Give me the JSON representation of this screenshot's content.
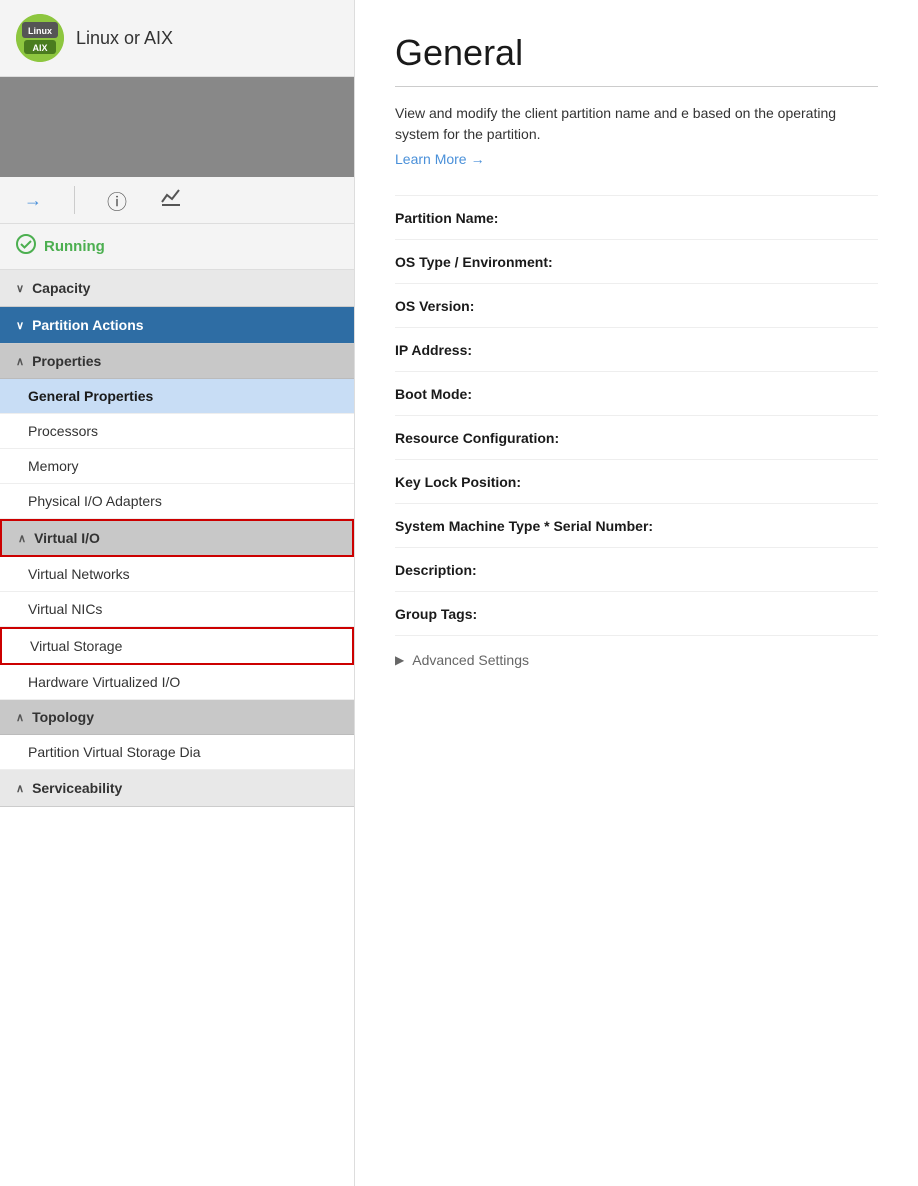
{
  "sidebar": {
    "logo": {
      "linux_label": "Linux",
      "aix_label": "AIX"
    },
    "title": "Linux or AIX",
    "nav": {
      "arrow": "→",
      "info_icon": "ⓘ",
      "chart_icon": "📈"
    },
    "status": {
      "label": "Running",
      "icon": "✔"
    },
    "sections": [
      {
        "id": "capacity",
        "label": "Capacity",
        "chevron": "∨",
        "active": false,
        "items": []
      },
      {
        "id": "partition-actions",
        "label": "Partition Actions",
        "chevron": "∨",
        "active": true,
        "items": []
      },
      {
        "id": "properties",
        "label": "Properties",
        "chevron": "∧",
        "sub": true,
        "items": [
          {
            "id": "general-properties",
            "label": "General Properties",
            "active": true
          },
          {
            "id": "processors",
            "label": "Processors",
            "active": false
          },
          {
            "id": "memory",
            "label": "Memory",
            "active": false
          },
          {
            "id": "physical-io-adapters",
            "label": "Physical I/O Adapters",
            "active": false
          }
        ]
      },
      {
        "id": "virtual-io",
        "label": "Virtual I/O",
        "chevron": "∧",
        "sub": true,
        "red_border": true,
        "items": [
          {
            "id": "virtual-networks",
            "label": "Virtual Networks",
            "active": false
          },
          {
            "id": "virtual-nics",
            "label": "Virtual NICs",
            "active": false
          },
          {
            "id": "virtual-storage",
            "label": "Virtual Storage",
            "active": false,
            "red_border": true
          },
          {
            "id": "hardware-virtualized-io",
            "label": "Hardware Virtualized I/O",
            "active": false
          }
        ]
      },
      {
        "id": "topology",
        "label": "Topology",
        "chevron": "∧",
        "sub": true,
        "items": [
          {
            "id": "partition-virtual-storage-dia",
            "label": "Partition Virtual Storage Dia",
            "active": false
          }
        ]
      },
      {
        "id": "serviceability",
        "label": "Serviceability",
        "chevron": "∧",
        "active": false,
        "items": []
      }
    ]
  },
  "main": {
    "title": "General",
    "description": "View and modify the client partition name and e based on the operating system for the partition.",
    "learn_more": "Learn More",
    "learn_more_arrow": "→",
    "fields": [
      {
        "id": "partition-name",
        "label": "Partition Name:",
        "value": ""
      },
      {
        "id": "os-type",
        "label": "OS Type / Environment:",
        "value": ""
      },
      {
        "id": "os-version",
        "label": "OS Version:",
        "value": ""
      },
      {
        "id": "ip-address",
        "label": "IP Address:",
        "value": ""
      },
      {
        "id": "boot-mode",
        "label": "Boot Mode:",
        "value": ""
      },
      {
        "id": "resource-configuration",
        "label": "Resource Configuration:",
        "value": ""
      },
      {
        "id": "key-lock-position",
        "label": "Key Lock Position:",
        "value": ""
      },
      {
        "id": "system-machine-type",
        "label": "System Machine Type * Serial Number:",
        "value": ""
      },
      {
        "id": "description",
        "label": "Description:",
        "value": ""
      },
      {
        "id": "group-tags",
        "label": "Group Tags:",
        "value": ""
      }
    ],
    "advanced_settings_label": "Advanced Settings",
    "advanced_chevron": "▶"
  }
}
